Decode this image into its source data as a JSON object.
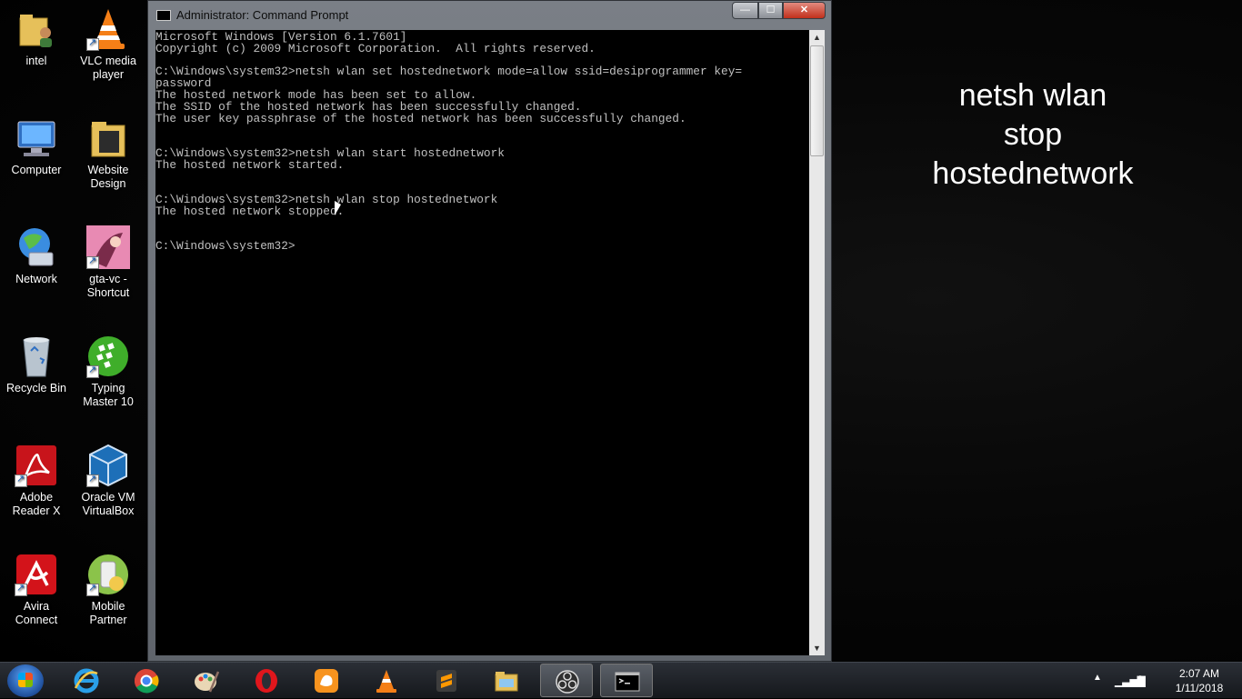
{
  "desktop_icons": [
    {
      "label": "intel",
      "icon": "folder-user-icon"
    },
    {
      "label": "VLC media\nplayer",
      "icon": "vlc-cone-icon"
    },
    {
      "label": "Computer",
      "icon": "computer-icon"
    },
    {
      "label": "Website\nDesign",
      "icon": "folder-icon"
    },
    {
      "label": "Network",
      "icon": "network-globe-icon"
    },
    {
      "label": "gta-vc -\nShortcut",
      "icon": "gta-vc-icon"
    },
    {
      "label": "Recycle Bin",
      "icon": "recycle-bin-icon"
    },
    {
      "label": "Typing\nMaster 10",
      "icon": "typing-master-icon"
    },
    {
      "label": "Adobe\nReader X",
      "icon": "adobe-reader-icon"
    },
    {
      "label": "Oracle VM\nVirtualBox",
      "icon": "virtualbox-icon"
    },
    {
      "label": "Avira\nConnect",
      "icon": "avira-icon"
    },
    {
      "label": "Mobile\nPartner",
      "icon": "mobile-partner-icon"
    }
  ],
  "overlay_text": "netsh wlan\nstop\nhostednetwork",
  "window": {
    "title": "Administrator: Command Prompt",
    "console_text": "Microsoft Windows [Version 6.1.7601]\nCopyright (c) 2009 Microsoft Corporation.  All rights reserved.\n\nC:\\Windows\\system32>netsh wlan set hostednetwork mode=allow ssid=desiprogrammer key=\npassword\nThe hosted network mode has been set to allow.\nThe SSID of the hosted network has been successfully changed.\nThe user key passphrase of the hosted network has been successfully changed.\n\n\nC:\\Windows\\system32>netsh wlan start hostednetwork\nThe hosted network started.\n\n\nC:\\Windows\\system32>netsh wlan stop hostednetwork\nThe hosted network stopped.\n\n\nC:\\Windows\\system32>",
    "buttons": {
      "minimize": "—",
      "maximize": "☐",
      "close": "✕"
    }
  },
  "taskbar": {
    "apps": [
      {
        "name": "internet-explorer-icon",
        "active": false
      },
      {
        "name": "chrome-icon",
        "active": false
      },
      {
        "name": "paint-icon",
        "active": false
      },
      {
        "name": "opera-icon",
        "active": false
      },
      {
        "name": "uc-browser-icon",
        "active": false
      },
      {
        "name": "vlc-icon",
        "active": false
      },
      {
        "name": "sublime-text-icon",
        "active": false
      },
      {
        "name": "file-explorer-icon",
        "active": false
      },
      {
        "name": "obs-icon",
        "active": true
      },
      {
        "name": "command-prompt-icon",
        "active": true
      }
    ],
    "clock_time": "2:07 AM",
    "clock_date": "1/11/2018"
  },
  "colors": {
    "console_bg": "#000000",
    "console_text": "#c0c0c0",
    "close_button": "#c1301b"
  }
}
